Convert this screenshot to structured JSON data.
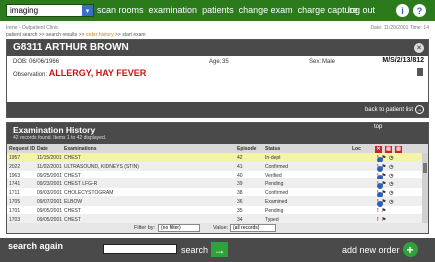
{
  "nav": {
    "department": "imaging",
    "links": [
      "scan rooms",
      "examination",
      "patients",
      "change exam",
      "charge capture"
    ],
    "logout": "log out"
  },
  "header": {
    "location": "Irene - Outpatient Clinic",
    "datetime": "Date: 11/20/2001 Time: 14",
    "breadcrumb": [
      "patient search",
      "search results",
      "order history",
      "start exam"
    ],
    "breadcrumb_sep": ">>"
  },
  "patient": {
    "id_name": "G8311 ARTHUR BROWN",
    "dob_label": "DOB:",
    "dob": "06/06/1966",
    "age_label": "Age:",
    "age": "35",
    "sex_label": "Sex:",
    "sex": "Male",
    "date": "M/S/2/13/812",
    "observation_label": "Observation:",
    "allergy": "ALLERGY, HAY FEVER",
    "back_link": "back to patient list"
  },
  "exam_history": {
    "title": "Examination History",
    "count_text": "42 records found. Items 1 to 42 displayed.",
    "top_link": "top",
    "columns": [
      "Request ID",
      "Date",
      "Examinations",
      "Episode",
      "Status",
      "Loc"
    ],
    "rows": [
      {
        "id": "1957",
        "date": "11/15/2001",
        "exam": "CHEST",
        "episode": "42",
        "status": "In-dept"
      },
      {
        "id": "2022",
        "date": "11/02/2001",
        "exam": "ULTRASOUND, KIDNEYS (STIN)",
        "episode": "41",
        "status": "Confirmed"
      },
      {
        "id": "1963",
        "date": "09/25/2001",
        "exam": "CHEST",
        "episode": "40",
        "status": "Verified"
      },
      {
        "id": "1741",
        "date": "09/23/2001",
        "exam": "CHEST LFG-R",
        "episode": "39",
        "status": "Pending"
      },
      {
        "id": "1711",
        "date": "09/03/2001",
        "exam": "CHOLECYSTOGRAM",
        "episode": "38",
        "status": "Confirmed"
      },
      {
        "id": "1705",
        "date": "09/07/2001",
        "exam": "ELBOW",
        "episode": "36",
        "status": "Examined"
      },
      {
        "id": "1701",
        "date": "09/05/2001",
        "exam": "CHEST",
        "episode": "35",
        "status": "Pending"
      },
      {
        "id": "1703",
        "date": "09/05/2001",
        "exam": "CHEST",
        "episode": "34",
        "status": "Typed"
      }
    ],
    "filter_label": "Filter by:",
    "filter_value": "(no filter)",
    "value_label": "Value:",
    "value_value": "(all records)"
  },
  "footer": {
    "search_again": "search again",
    "search_button": "search",
    "add_new_order": "add new order"
  },
  "colors": {
    "nav_green": "#2b7b1d",
    "panel_dark": "#4a4a4a",
    "selected_row": "#f4f3a6",
    "allergy_red": "#cc1111",
    "action_green": "#2ea33a"
  }
}
